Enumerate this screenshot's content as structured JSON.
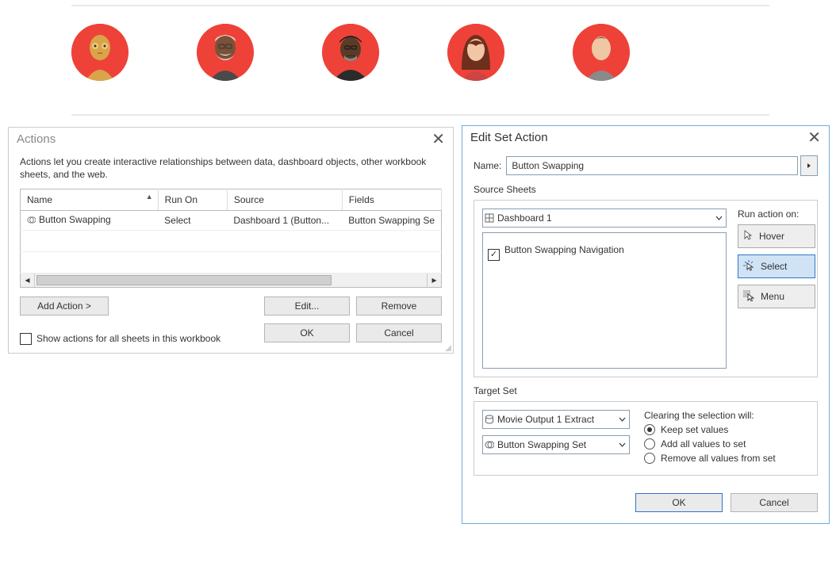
{
  "actions_dialog": {
    "title": "Actions",
    "description": "Actions let you create interactive relationships between data, dashboard objects, other workbook sheets, and the web.",
    "columns": {
      "name": "Name",
      "run_on": "Run On",
      "source": "Source",
      "fields": "Fields"
    },
    "rows": [
      {
        "name": "Button Swapping",
        "run_on": "Select",
        "source": "Dashboard 1 (Button...",
        "fields": "Button Swapping Se"
      }
    ],
    "add_action": "Add Action >",
    "edit": "Edit...",
    "remove": "Remove",
    "show_all": "Show actions for all sheets in this workbook",
    "ok": "OK",
    "cancel": "Cancel"
  },
  "edit_dialog": {
    "title": "Edit Set Action",
    "name_label": "Name:",
    "name_value": "Button Swapping",
    "source_sheets_label": "Source Sheets",
    "dashboard_value": "Dashboard 1",
    "sheet_item": "Button Swapping Navigation",
    "run_label": "Run action on:",
    "hover": "Hover",
    "select": "Select",
    "menu": "Menu",
    "target_set_label": "Target Set",
    "datasource": "Movie Output 1 Extract",
    "set": "Button Swapping Set",
    "clearing_label": "Clearing the selection will:",
    "keep": "Keep set values",
    "add_all": "Add all values to set",
    "remove_all": "Remove all values from set",
    "ok": "OK",
    "cancel": "Cancel"
  }
}
